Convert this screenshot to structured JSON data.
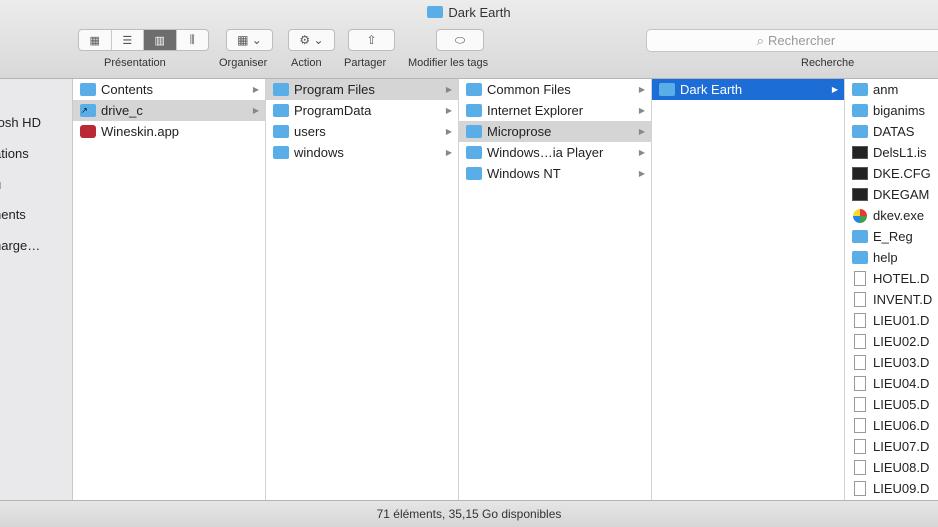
{
  "window": {
    "title": "Dark Earth"
  },
  "toolbar": {
    "view_label": "Présentation",
    "arrange_label": "Organiser",
    "action_label": "Action",
    "share_label": "Partager",
    "tags_label": "Modifier les tags",
    "search_label": "Recherche",
    "search_placeholder": "Rechercher"
  },
  "sidebar": {
    "items": [
      "tosh HD",
      "ations",
      "u",
      "nents",
      "harge…"
    ]
  },
  "columns": [
    {
      "items": [
        {
          "label": "Contents",
          "icon": "folder",
          "arrow": true,
          "state": ""
        },
        {
          "label": "drive_c",
          "icon": "folder-alias",
          "arrow": true,
          "state": "sel-grey"
        },
        {
          "label": "Wineskin.app",
          "icon": "app",
          "arrow": false,
          "state": ""
        }
      ]
    },
    {
      "items": [
        {
          "label": "Program Files",
          "icon": "folder",
          "arrow": true,
          "state": "sel-grey"
        },
        {
          "label": "ProgramData",
          "icon": "folder",
          "arrow": true,
          "state": ""
        },
        {
          "label": "users",
          "icon": "folder",
          "arrow": true,
          "state": ""
        },
        {
          "label": "windows",
          "icon": "folder",
          "arrow": true,
          "state": ""
        }
      ]
    },
    {
      "items": [
        {
          "label": "Common Files",
          "icon": "folder",
          "arrow": true,
          "state": ""
        },
        {
          "label": "Internet Explorer",
          "icon": "folder",
          "arrow": true,
          "state": ""
        },
        {
          "label": "Microprose",
          "icon": "folder",
          "arrow": true,
          "state": "sel-grey"
        },
        {
          "label": "Windows…ia Player",
          "icon": "folder",
          "arrow": true,
          "state": ""
        },
        {
          "label": "Windows NT",
          "icon": "folder",
          "arrow": true,
          "state": ""
        }
      ]
    },
    {
      "items": [
        {
          "label": "Dark Earth",
          "icon": "folder",
          "arrow": true,
          "state": "sel-blue"
        }
      ]
    },
    {
      "items": [
        {
          "label": "anm",
          "icon": "folder",
          "arrow": false,
          "state": ""
        },
        {
          "label": "biganims",
          "icon": "folder",
          "arrow": false,
          "state": ""
        },
        {
          "label": "DATAS",
          "icon": "folder",
          "arrow": false,
          "state": ""
        },
        {
          "label": "DelsL1.is",
          "icon": "term",
          "arrow": false,
          "state": ""
        },
        {
          "label": "DKE.CFG",
          "icon": "term",
          "arrow": false,
          "state": ""
        },
        {
          "label": "DKEGAM",
          "icon": "term",
          "arrow": false,
          "state": ""
        },
        {
          "label": "dkev.exe",
          "icon": "exe",
          "arrow": false,
          "state": ""
        },
        {
          "label": "E_Reg",
          "icon": "folder",
          "arrow": false,
          "state": ""
        },
        {
          "label": "help",
          "icon": "folder",
          "arrow": false,
          "state": ""
        },
        {
          "label": "HOTEL.D",
          "icon": "doc",
          "arrow": false,
          "state": ""
        },
        {
          "label": "INVENT.D",
          "icon": "doc",
          "arrow": false,
          "state": ""
        },
        {
          "label": "LIEU01.D",
          "icon": "doc",
          "arrow": false,
          "state": ""
        },
        {
          "label": "LIEU02.D",
          "icon": "doc",
          "arrow": false,
          "state": ""
        },
        {
          "label": "LIEU03.D",
          "icon": "doc",
          "arrow": false,
          "state": ""
        },
        {
          "label": "LIEU04.D",
          "icon": "doc",
          "arrow": false,
          "state": ""
        },
        {
          "label": "LIEU05.D",
          "icon": "doc",
          "arrow": false,
          "state": ""
        },
        {
          "label": "LIEU06.D",
          "icon": "doc",
          "arrow": false,
          "state": ""
        },
        {
          "label": "LIEU07.D",
          "icon": "doc",
          "arrow": false,
          "state": ""
        },
        {
          "label": "LIEU08.D",
          "icon": "doc",
          "arrow": false,
          "state": ""
        },
        {
          "label": "LIEU09.D",
          "icon": "doc",
          "arrow": false,
          "state": ""
        }
      ]
    }
  ],
  "status": {
    "text": "71 éléments, 35,15 Go disponibles"
  },
  "colors": {
    "selection_blue": "#1d6dd6",
    "selection_grey": "#d5d5d5",
    "folder_blue": "#5aaee8"
  }
}
